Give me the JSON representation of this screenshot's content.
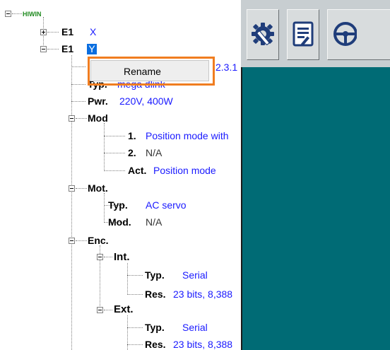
{
  "tree": {
    "root_label": "HIWIN",
    "nodes": {
      "e1_first": {
        "label": "E1",
        "value": "X"
      },
      "e1_second": {
        "label": "E1",
        "value": "Y"
      },
      "ver_value": "2.3.1",
      "typ": {
        "label": "Typ.",
        "value": "mega dlink"
      },
      "pwr": {
        "label": "Pwr.",
        "value": "220V, 400W"
      },
      "mod": {
        "label": "Mod",
        "items": [
          {
            "label": "1.",
            "value": "Position mode with"
          },
          {
            "label": "2.",
            "value": "N/A"
          },
          {
            "label": "Act.",
            "value": "Position mode"
          }
        ]
      },
      "mot": {
        "label": "Mot.",
        "items": [
          {
            "label": "Typ.",
            "value": "AC servo"
          },
          {
            "label": "Mod.",
            "value": "N/A"
          }
        ]
      },
      "enc": {
        "label": "Enc.",
        "int": {
          "label": "Int.",
          "items": [
            {
              "label": "Typ.",
              "value": "Serial"
            },
            {
              "label": "Res.",
              "value": "23 bits, 8,388"
            }
          ]
        },
        "ext": {
          "label": "Ext.",
          "items": [
            {
              "label": "Typ.",
              "value": "Serial"
            },
            {
              "label": "Res.",
              "value": "23 bits, 8,388"
            }
          ]
        }
      }
    }
  },
  "context_menu": {
    "items": [
      "Rename"
    ]
  },
  "toolbar": {
    "buttons": [
      "settings-wrench-icon",
      "notes-document-icon",
      "steering-wheel-icon"
    ]
  },
  "colors": {
    "panel": "#006b75",
    "value_text": "#1a1aff",
    "root_text": "#1f8a1f",
    "highlight_frame": "#f07d20",
    "selection": "#0a6ee0"
  }
}
